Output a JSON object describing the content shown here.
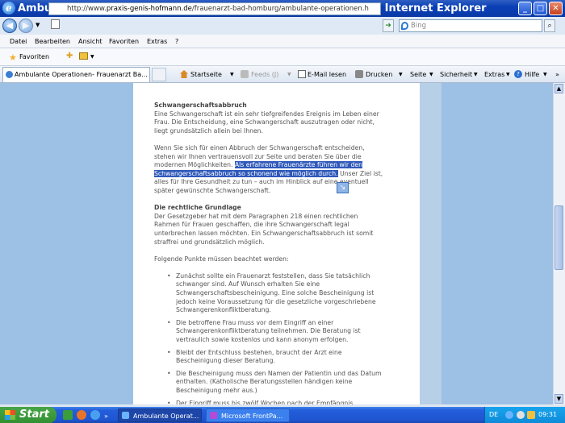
{
  "window": {
    "title": "Ambulante Operationen- Frauenarzt Bad Homburg - Windows Internet Explorer",
    "controls": {
      "minimize": "_",
      "maximize": "□",
      "close": "✕"
    }
  },
  "address": {
    "url_prefix": "http://www.",
    "url_domain": "praxis-genis-hofmann.de",
    "url_path": "/frauenarzt-bad-homburg/ambulante-operationen.h",
    "search_placeholder": "Bing"
  },
  "menu": [
    "Datei",
    "Bearbeiten",
    "Ansicht",
    "Favoriten",
    "Extras",
    "?"
  ],
  "favorites": {
    "label": "Favoriten"
  },
  "tab": {
    "label": "Ambulante Operationen- Frauenarzt Ba..."
  },
  "command_bar": {
    "home": "Startseite",
    "feeds": "Feeds (J)",
    "email": "E-Mail lesen",
    "print": "Drucken",
    "page": "Seite",
    "safety": "Sicherheit",
    "tools": "Extras",
    "help": "Hilfe"
  },
  "article": {
    "heading1": "Schwangerschaftsabbruch",
    "para1": "Eine Schwangerschaft ist ein sehr tiefgreifendes Ereignis im Leben einer Frau. Die Entscheidung, eine Schwangerschaft auszutragen oder nicht, liegt grundsätzlich allein bei Ihnen.",
    "para2_start": "Wenn Sie sich für einen Abbruch der Schwangerschaft entscheiden, stehen wir Ihnen vertrauensvoll zur Seite und beraten Sie über die modernen Möglichkeiten.",
    "para2_highlight": "Als erfahrene Frauenärzte führen wir den Schwangerschaftsabbruch so schonend wie möglich durch.",
    "para2_end": "Unser Ziel ist, alles für Ihre Gesundheit zu tun – auch im Hinblick auf eine eventuell später gewünschte Schwangerschaft.",
    "heading2": "Die rechtliche Grundlage",
    "para3": "Der Gesetzgeber hat mit dem Paragraphen 218 einen rechtlichen Rahmen für Frauen geschaffen, die ihre Schwangerschaft legal unterbrechen lassen möchten. Ein Schwangerschaftsabbruch ist somit straffrei und grundsätzlich möglich.",
    "para4": "Folgende Punkte müssen beachtet werden:",
    "bullets": [
      "Zunächst sollte ein Frauenarzt feststellen, dass Sie tatsächlich schwanger sind. Auf Wunsch erhalten Sie eine Schwangerschaftsbescheinigung. Eine solche Bescheinigung ist jedoch keine Voraussetzung für die gesetzliche vorgeschriebene Schwangerenkonfliktberatung.",
      "Die betroffene Frau muss vor dem Eingriff an einer Schwangerenkonfliktberatung teilnehmen. Die Beratung ist vertraulich sowie kostenlos und kann anonym erfolgen.",
      "Bleibt der Entschluss bestehen, braucht der Arzt eine Bescheinigung dieser Beratung.",
      "Die Bescheinigung muss den Namen der Patientin und das Datum enthalten. (Katholische Beratungsstellen händigen keine Bescheinigung mehr aus.)",
      "Der Eingriff muss bis zwölf Wochen nach der Empfängnis durchgeführt werden."
    ]
  },
  "taskbar": {
    "start": "Start",
    "tasks": [
      "Ambulante Operat...",
      "Microsoft FrontPa..."
    ],
    "language": "DE",
    "clock": "09:31"
  }
}
